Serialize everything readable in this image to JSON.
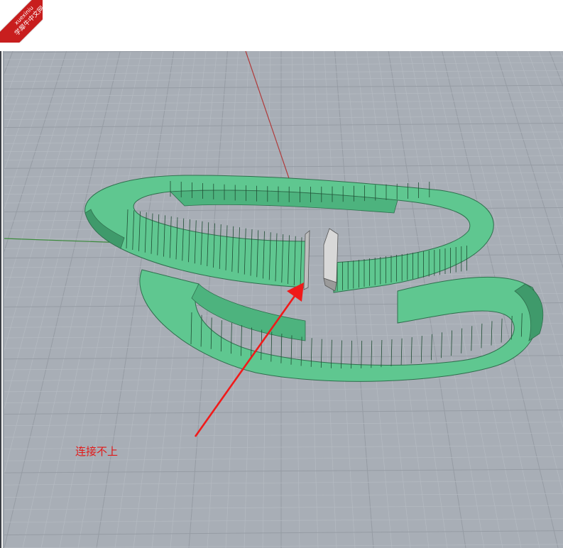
{
  "watermark": {
    "line1": "xuexiniu",
    "line2": "学犀牛中文网"
  },
  "annotation": {
    "text": "连接不上"
  },
  "colors": {
    "viewport_bg": "#a8aeb6",
    "grid_minor": "#b5bbc2",
    "grid_major": "#969ca4",
    "x_axis": "#b03a3a",
    "y_axis": "#3a8a3a",
    "surface": "#5fc790",
    "surface_dark": "#3f9a6b",
    "gap_face": "#d8d8d8",
    "arrow": "#f01a1a"
  },
  "icons": {
    "arrow": "red-arrow-icon"
  }
}
